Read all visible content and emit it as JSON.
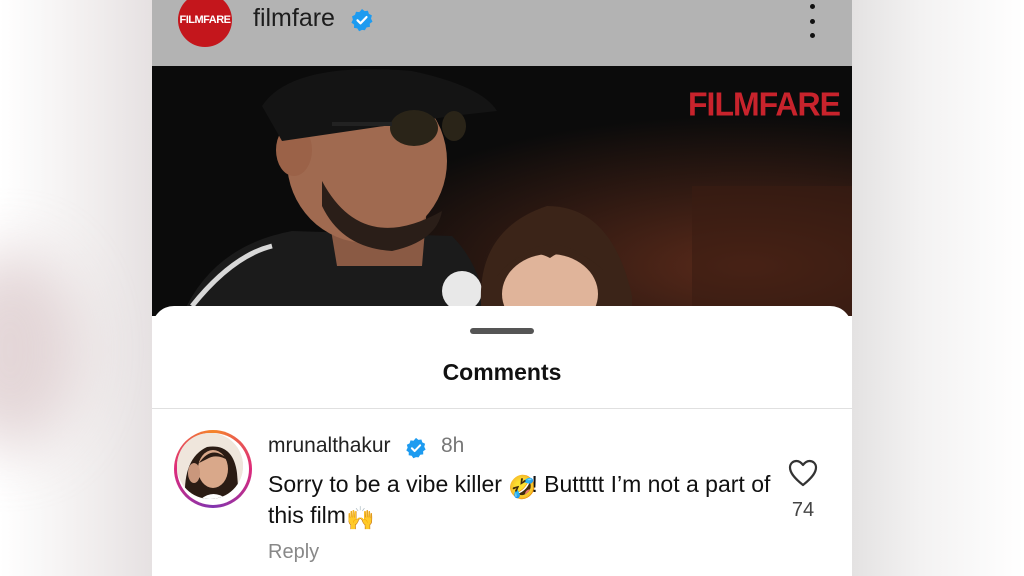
{
  "post": {
    "account": "filmfare",
    "avatar_text": "FILMFARE",
    "photo_watermark": "FILMFARE"
  },
  "comments_sheet": {
    "title": "Comments",
    "comment": {
      "username": "mrunalthakur",
      "time": "8h",
      "text_part1": "Sorry to be a vibe killer ",
      "emoji1": "🤣",
      "text_part2": "! Buttttt I’m not a part of this film",
      "emoji2": "🙌",
      "reply_label": "Reply",
      "likes": "74"
    }
  },
  "colors": {
    "brand_red": "#c4161c",
    "verified_blue": "#1d9bf0",
    "header_gray": "#b3b3b3"
  },
  "icons": [
    "verified-badge-icon",
    "more-options-icon",
    "heart-icon"
  ]
}
